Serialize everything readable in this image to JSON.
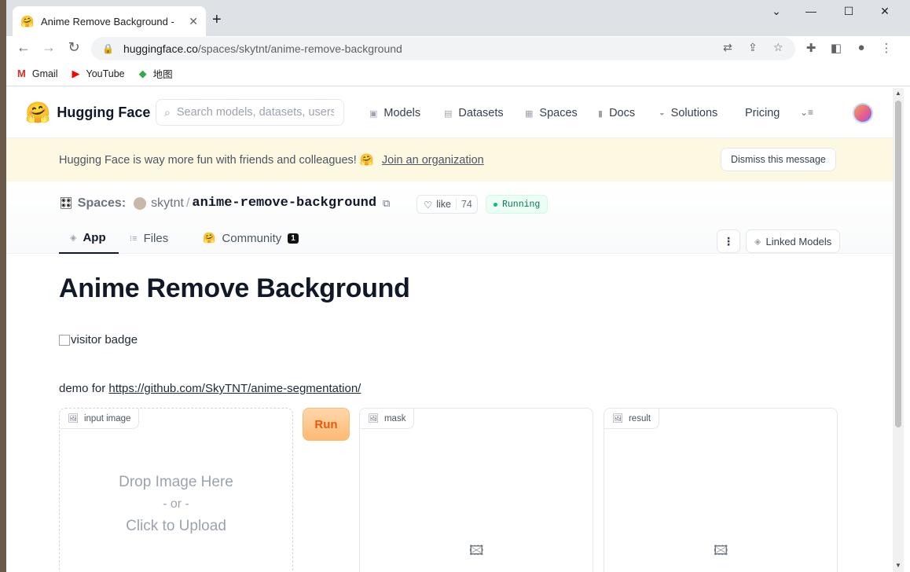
{
  "browser": {
    "tab_title": "Anime Remove Background - ",
    "tab_favicon": "🤗",
    "new_tab": "+",
    "url_host": "huggingface.co",
    "url_path": "/spaces/skytnt/anime-remove-background",
    "window_controls": {
      "minimize": "—",
      "maximize": "☐",
      "close": "✕",
      "dropdown": "⌄"
    },
    "bookmarks": [
      {
        "label": "Gmail",
        "icon": "M",
        "color": "#d93025"
      },
      {
        "label": "YouTube",
        "icon": "▶",
        "color": "#ff0000"
      },
      {
        "label": "地图",
        "icon": "◆",
        "color": "#34a853"
      }
    ]
  },
  "hf": {
    "logo": "🤗",
    "brand": "Hugging Face",
    "search_placeholder": "Search models, datasets, users...",
    "nav": [
      {
        "label": "Models",
        "icon": "▣"
      },
      {
        "label": "Datasets",
        "icon": "▤"
      },
      {
        "label": "Spaces",
        "icon": "▦"
      },
      {
        "label": "Docs",
        "icon": "▮"
      },
      {
        "label": "Solutions",
        "icon": "◒"
      },
      {
        "label": "Pricing",
        "icon": ""
      }
    ],
    "more_icon": "⌄≡"
  },
  "banner": {
    "text": "Hugging Face is way more fun with friends and colleagues! 🤗",
    "link": "Join an organization",
    "dismiss": "Dismiss this message"
  },
  "space": {
    "label": "Spaces:",
    "user": "skytnt",
    "repo": "anime-remove-background",
    "like_label": "like",
    "like_count": "74",
    "status": "Running",
    "tabs": [
      {
        "label": "App",
        "icon": "◈"
      },
      {
        "label": "Files",
        "icon": "⁝≡"
      },
      {
        "label": "Community",
        "icon": "🤗",
        "badge": "1"
      }
    ],
    "kebab": "⋮",
    "linked_models": "Linked Models"
  },
  "app": {
    "title": "Anime Remove Background",
    "badge_alt": "visitor badge",
    "demo_prefix": "demo for ",
    "demo_link": "https://github.com/SkyTNT/anime-segmentation/",
    "run": "Run",
    "panels": [
      {
        "label": "input image",
        "upload_main": "Drop Image Here",
        "upload_or": "- or -",
        "upload_click": "Click to Upload"
      },
      {
        "label": "mask"
      },
      {
        "label": "result"
      }
    ]
  }
}
